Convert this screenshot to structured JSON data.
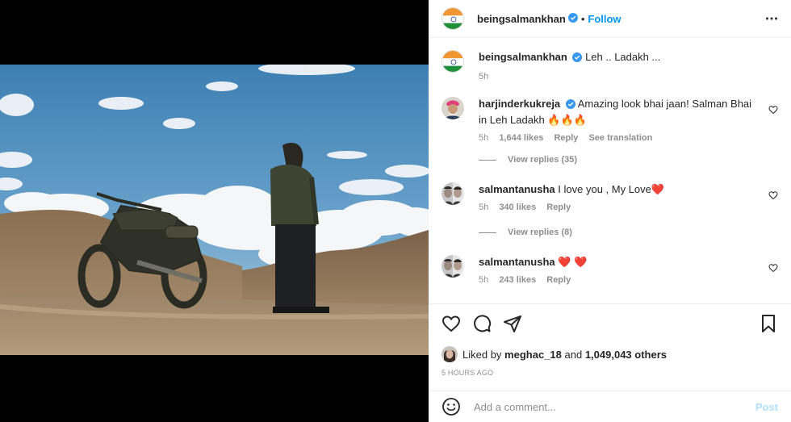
{
  "post": {
    "author": "beingsalmankhan",
    "follow_label": "Follow",
    "separator": "•",
    "caption": {
      "username": "beingsalmankhan",
      "text": "Leh .. Ladakh ...",
      "time": "5h"
    },
    "comments": [
      {
        "username": "harjinderkukreja",
        "verified": true,
        "text": "Amazing look bhai jaan! Salman Bhai in Leh Ladakh 🔥🔥🔥",
        "time": "5h",
        "likes": "1,644 likes",
        "reply_label": "Reply",
        "translate_label": "See translation",
        "view_replies": "View replies (35)"
      },
      {
        "username": "salmantanusha",
        "verified": false,
        "text": "I love you , My Love❤️",
        "time": "5h",
        "likes": "340 likes",
        "reply_label": "Reply",
        "view_replies": "View replies (8)"
      },
      {
        "username": "salmantanusha",
        "verified": false,
        "text": "❤️ ❤️",
        "time": "5h",
        "likes": "243 likes",
        "reply_label": "Reply"
      }
    ],
    "liked_by": {
      "prefix": "Liked by",
      "user": "meghac_18",
      "and": "and",
      "others": "1,049,043 others"
    },
    "timestamp": "5 HOURS AGO",
    "add_comment_placeholder": "Add a comment...",
    "post_label": "Post"
  },
  "colors": {
    "accent": "#0095f6",
    "post_disabled": "#b2dffc",
    "text": "#262626",
    "muted": "#8e8e8e",
    "heart_red": "#ed4956"
  },
  "icons": [
    "india-flag-avatar",
    "verified-badge-icon",
    "more-icon",
    "heart-icon",
    "comment-icon",
    "share-icon",
    "bookmark-icon",
    "emoji-icon"
  ]
}
